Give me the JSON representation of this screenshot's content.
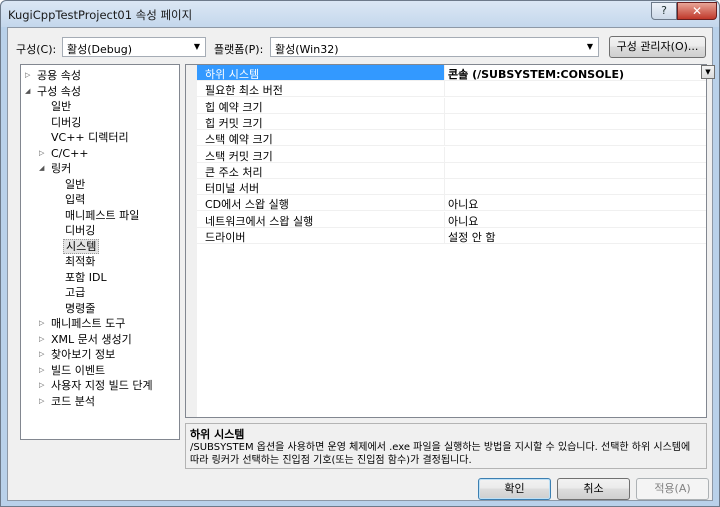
{
  "window": {
    "title": "KugiCppTestProject01 속성 페이지",
    "help_label": "?",
    "close_label": "✕"
  },
  "toolbar": {
    "config_label": "구성(C):",
    "config_value": "활성(Debug)",
    "platform_label": "플랫폼(P):",
    "platform_value": "활성(Win32)",
    "config_manager_label": "구성 관리자(O)..."
  },
  "tree": {
    "items": [
      {
        "label": "공용 속성",
        "expander": "▷"
      },
      {
        "label": "구성 속성",
        "expander": "◢"
      },
      {
        "label": "일반",
        "expander": ""
      },
      {
        "label": "디버깅",
        "expander": ""
      },
      {
        "label": "VC++ 디렉터리",
        "expander": ""
      },
      {
        "label": "C/C++",
        "expander": "▷"
      },
      {
        "label": "링커",
        "expander": "◢"
      },
      {
        "label": "일반",
        "expander": ""
      },
      {
        "label": "입력",
        "expander": ""
      },
      {
        "label": "매니페스트 파일",
        "expander": ""
      },
      {
        "label": "디버깅",
        "expander": ""
      },
      {
        "label": "시스템",
        "expander": ""
      },
      {
        "label": "최적화",
        "expander": ""
      },
      {
        "label": "포함 IDL",
        "expander": ""
      },
      {
        "label": "고급",
        "expander": ""
      },
      {
        "label": "명령줄",
        "expander": ""
      },
      {
        "label": "매니페스트 도구",
        "expander": "▷"
      },
      {
        "label": "XML 문서 생성기",
        "expander": "▷"
      },
      {
        "label": "찾아보기 정보",
        "expander": "▷"
      },
      {
        "label": "빌드 이벤트",
        "expander": "▷"
      },
      {
        "label": "사용자 지정 빌드 단계",
        "expander": "▷"
      },
      {
        "label": "코드 분석",
        "expander": "▷"
      }
    ]
  },
  "grid": {
    "rows": [
      {
        "name": "하위 시스템",
        "value": "콘솔 (/SUBSYSTEM:CONSOLE)"
      },
      {
        "name": "필요한 최소 버전",
        "value": ""
      },
      {
        "name": "힙 예약 크기",
        "value": ""
      },
      {
        "name": "힙 커밋 크기",
        "value": ""
      },
      {
        "name": "스택 예약 크기",
        "value": ""
      },
      {
        "name": "스택 커밋 크기",
        "value": ""
      },
      {
        "name": "큰 주소 처리",
        "value": ""
      },
      {
        "name": "터미널 서버",
        "value": ""
      },
      {
        "name": "CD에서 스왑 실행",
        "value": "아니요"
      },
      {
        "name": "네트워크에서 스왑 실행",
        "value": "아니요"
      },
      {
        "name": "드라이버",
        "value": "설정 안 함"
      }
    ],
    "dropdown_glyph": "▼"
  },
  "description": {
    "title": "하위 시스템",
    "body": "/SUBSYSTEM 옵션을 사용하면 운영 체제에서 .exe 파일을 실행하는 방법을 지시할 수 있습니다. 선택한 하위 시스템에 따라 링커가 선택하는 진입점 기호(또는 진입점 함수)가 결정됩니다."
  },
  "footer": {
    "ok_label": "확인",
    "cancel_label": "취소",
    "apply_label": "적용(A)"
  }
}
